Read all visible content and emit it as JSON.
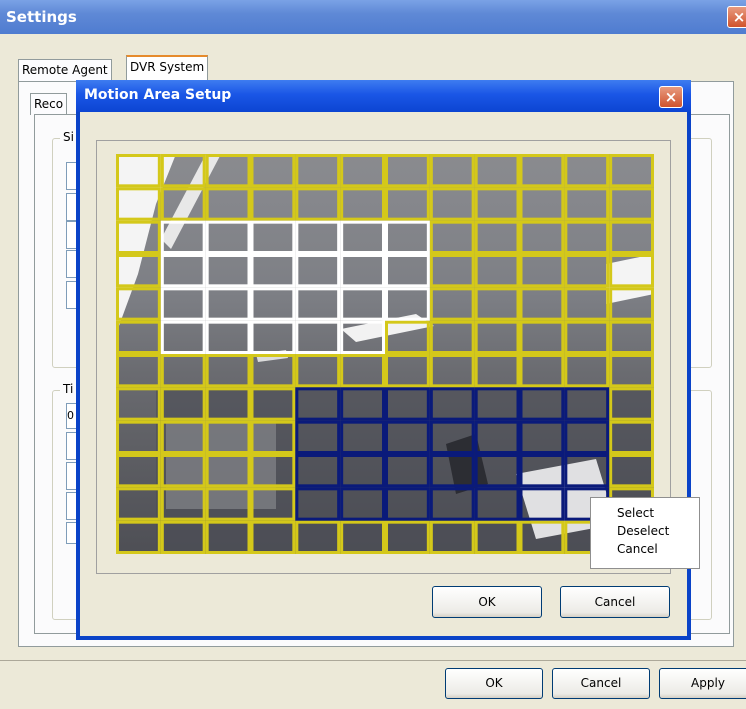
{
  "settings": {
    "title": "Settings",
    "close_glyph": "×",
    "tabs": [
      "Remote Agent",
      "DVR System"
    ],
    "inner_tab": "Reco",
    "group1_label": "Si",
    "group2_label": "Ti",
    "field_value": "0",
    "buttons": {
      "ok": "OK",
      "cancel": "Cancel",
      "apply": "Apply"
    }
  },
  "motion": {
    "title": "Motion Area Setup",
    "close_glyph": "×",
    "buttons": {
      "ok": "OK",
      "cancel": "Cancel"
    },
    "grid": {
      "rows": 12,
      "cols": 12,
      "selected": [
        [
          2,
          1
        ],
        [
          2,
          2
        ],
        [
          2,
          3
        ],
        [
          2,
          4
        ],
        [
          2,
          5
        ],
        [
          2,
          6
        ],
        [
          3,
          1
        ],
        [
          3,
          2
        ],
        [
          3,
          3
        ],
        [
          3,
          4
        ],
        [
          3,
          5
        ],
        [
          3,
          6
        ],
        [
          4,
          1
        ],
        [
          4,
          2
        ],
        [
          4,
          3
        ],
        [
          4,
          4
        ],
        [
          4,
          5
        ],
        [
          4,
          6
        ],
        [
          5,
          1
        ],
        [
          5,
          2
        ],
        [
          5,
          3
        ],
        [
          5,
          4
        ],
        [
          5,
          5
        ]
      ],
      "masked": [
        [
          7,
          4
        ],
        [
          7,
          5
        ],
        [
          7,
          6
        ],
        [
          7,
          7
        ],
        [
          7,
          8
        ],
        [
          7,
          9
        ],
        [
          7,
          10
        ],
        [
          8,
          4
        ],
        [
          8,
          5
        ],
        [
          8,
          6
        ],
        [
          8,
          7
        ],
        [
          8,
          8
        ],
        [
          8,
          9
        ],
        [
          8,
          10
        ],
        [
          9,
          4
        ],
        [
          9,
          5
        ],
        [
          9,
          6
        ],
        [
          9,
          7
        ],
        [
          9,
          8
        ],
        [
          9,
          9
        ],
        [
          9,
          10
        ],
        [
          10,
          4
        ],
        [
          10,
          5
        ],
        [
          10,
          6
        ],
        [
          10,
          7
        ],
        [
          10,
          8
        ],
        [
          10,
          9
        ],
        [
          10,
          10
        ]
      ],
      "colors": {
        "default": "#d4c81a",
        "selected": "#ffffff",
        "masked": "#0a1a7a"
      }
    }
  },
  "context_menu": {
    "items": [
      "Select",
      "Deselect",
      "Cancel"
    ]
  }
}
